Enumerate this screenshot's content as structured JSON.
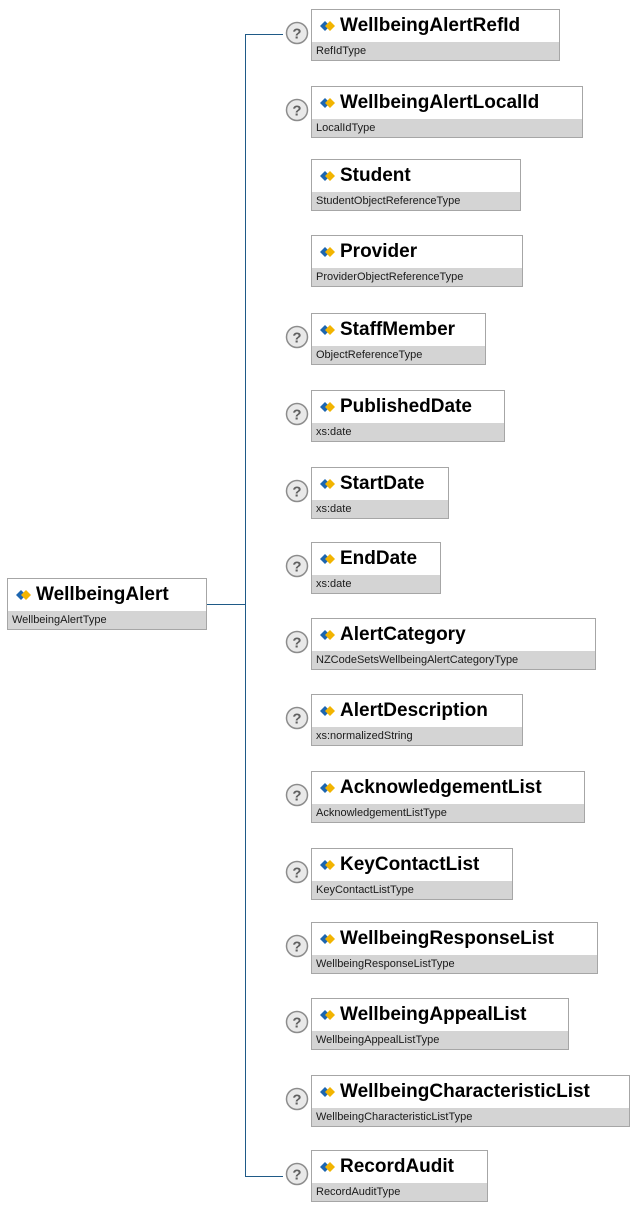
{
  "root": {
    "name": "WellbeingAlert",
    "type": "WellbeingAlertType"
  },
  "children": [
    {
      "name": "WellbeingAlertRefId",
      "type": "RefIdType",
      "optional": true
    },
    {
      "name": "WellbeingAlertLocalId",
      "type": "LocalIdType",
      "optional": true
    },
    {
      "name": "Student",
      "type": "StudentObjectReferenceType",
      "optional": false
    },
    {
      "name": "Provider",
      "type": "ProviderObjectReferenceType",
      "optional": false
    },
    {
      "name": "StaffMember",
      "type": "ObjectReferenceType",
      "optional": true
    },
    {
      "name": "PublishedDate",
      "type": "xs:date",
      "optional": true
    },
    {
      "name": "StartDate",
      "type": "xs:date",
      "optional": true
    },
    {
      "name": "EndDate",
      "type": "xs:date",
      "optional": true
    },
    {
      "name": "AlertCategory",
      "type": "NZCodeSetsWellbeingAlertCategoryType",
      "optional": true
    },
    {
      "name": "AlertDescription",
      "type": "xs:normalizedString",
      "optional": true
    },
    {
      "name": "AcknowledgementList",
      "type": "AcknowledgementListType",
      "optional": true
    },
    {
      "name": "KeyContactList",
      "type": "KeyContactListType",
      "optional": true
    },
    {
      "name": "WellbeingResponseList",
      "type": "WellbeingResponseListType",
      "optional": true
    },
    {
      "name": "WellbeingAppealList",
      "type": "WellbeingAppealListType",
      "optional": true
    },
    {
      "name": "WellbeingCharacteristicList",
      "type": "WellbeingCharacteristicListType",
      "optional": true
    },
    {
      "name": "RecordAudit",
      "type": "RecordAuditType",
      "optional": true
    }
  ],
  "colors": {
    "connector": "#1f5a87",
    "typeBand": "#d4d4d4",
    "border": "#a6a6a6"
  }
}
